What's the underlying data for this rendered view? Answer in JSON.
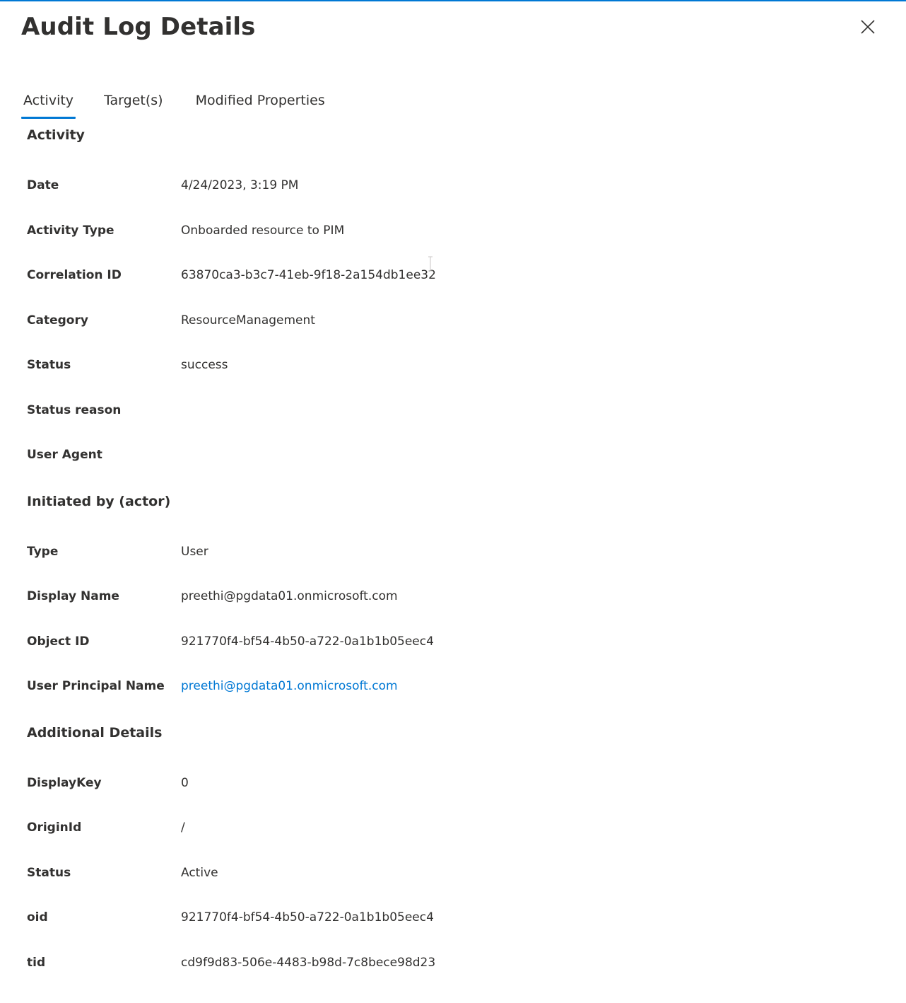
{
  "panel": {
    "title": "Audit Log Details"
  },
  "tabs": [
    {
      "label": "Activity",
      "active": true
    },
    {
      "label": "Target(s)",
      "active": false
    },
    {
      "label": "Modified Properties",
      "active": false
    }
  ],
  "activity": {
    "heading": "Activity",
    "rows": [
      {
        "label": "Date",
        "value": "4/24/2023, 3:19 PM"
      },
      {
        "label": "Activity Type",
        "value": "Onboarded resource to PIM"
      },
      {
        "label": "Correlation ID",
        "value": "63870ca3-b3c7-41eb-9f18-2a154db1ee32"
      },
      {
        "label": "Category",
        "value": "ResourceManagement"
      },
      {
        "label": "Status",
        "value": "success"
      },
      {
        "label": "Status reason",
        "value": ""
      },
      {
        "label": "User Agent",
        "value": ""
      }
    ]
  },
  "actor": {
    "heading": "Initiated by (actor)",
    "rows": [
      {
        "label": "Type",
        "value": "User"
      },
      {
        "label": "Display Name",
        "value": "preethi@pgdata01.onmicrosoft.com"
      },
      {
        "label": "Object ID",
        "value": "921770f4-bf54-4b50-a722-0a1b1b05eec4"
      },
      {
        "label": "User Principal Name",
        "value": "preethi@pgdata01.onmicrosoft.com"
      }
    ]
  },
  "additional": {
    "heading": "Additional Details",
    "rows": [
      {
        "label": "DisplayKey",
        "value": "0"
      },
      {
        "label": "OriginId",
        "value": "/"
      },
      {
        "label": "Status",
        "value": "Active"
      },
      {
        "label": "oid",
        "value": "921770f4-bf54-4b50-a722-0a1b1b05eec4"
      },
      {
        "label": "tid",
        "value": "cd9f9d83-506e-4483-b98d-7c8bece98d23"
      }
    ]
  },
  "colors": {
    "accent": "#0078d4",
    "text": "#323130"
  }
}
